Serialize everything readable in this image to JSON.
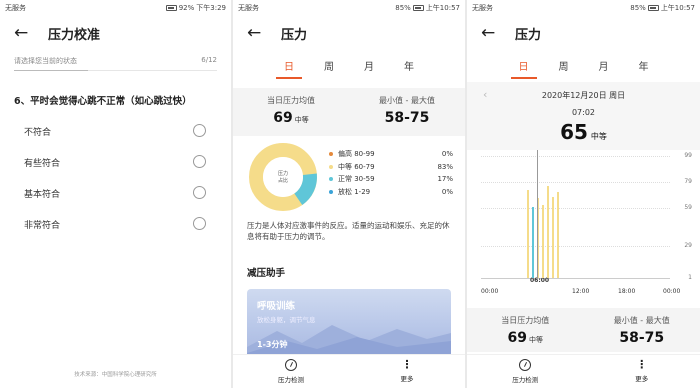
{
  "screen1": {
    "status": {
      "left": "无服务",
      "battery": "92%",
      "time": "下午3:29"
    },
    "title": "压力校准",
    "hint": "请选择您当前的状态",
    "page": "6/12",
    "question": "6、平时会觉得心跳不正常（如心跳过快）",
    "options": [
      "不符合",
      "有些符合",
      "基本符合",
      "非常符合"
    ],
    "source": "技术来源：中国科学院心理研究所"
  },
  "screen2": {
    "status": {
      "left": "无服务",
      "battery": "85%",
      "time": "上午10:57"
    },
    "title": "压力",
    "tabs": [
      "日",
      "周",
      "月",
      "年"
    ],
    "avg_label": "当日压力均值",
    "avg_value": "69",
    "avg_unit": "中等",
    "range_label": "最小值 - 最大值",
    "range_value": "58-75",
    "donut_center": "压力\n占比",
    "legend": [
      {
        "label": "偏高 80-99",
        "pct": "0%",
        "color": "#e58a3c"
      },
      {
        "label": "中等 60-79",
        "pct": "83%",
        "color": "#f5dc8a"
      },
      {
        "label": "正常 30-59",
        "pct": "17%",
        "color": "#5fc6d8"
      },
      {
        "label": "放松 1-29",
        "pct": "0%",
        "color": "#3aa3d8"
      }
    ],
    "description": "压力是人体对应激事件的反应。适量的运动和娱乐、充足的休息将有助于压力的调节。",
    "section_title": "减压助手",
    "card": {
      "title": "呼吸训练",
      "subtitle": "放松身躯，调节气息",
      "duration": "1-3分钟"
    },
    "bottom": {
      "detect": "压力检测",
      "more": "更多"
    }
  },
  "screen3": {
    "status": {
      "left": "无服务",
      "battery": "85%",
      "time": "上午10:57"
    },
    "title": "压力",
    "tabs": [
      "日",
      "周",
      "月",
      "年"
    ],
    "date": "2020年12月20日 周日",
    "time": "07:02",
    "value": "65",
    "unit": "中等",
    "y_ticks": [
      "99",
      "79",
      "59",
      "29",
      "1"
    ],
    "x_ticks": [
      "00:00",
      "06:00",
      "12:00",
      "18:00",
      "00:00"
    ],
    "avg_label": "当日压力均值",
    "avg_value": "69",
    "avg_unit": "中等",
    "range_label": "最小值 - 最大值",
    "range_value": "58-75",
    "bottom": {
      "detect": "压力检测",
      "more": "更多"
    }
  },
  "chart_data": {
    "type": "bar",
    "x": [
      "06:40",
      "06:50",
      "07:02",
      "07:10",
      "07:20",
      "07:30",
      "07:40"
    ],
    "values": [
      72,
      58,
      65,
      60,
      75,
      66,
      70
    ],
    "ylim": [
      1,
      99
    ],
    "yticks": [
      99,
      79,
      59,
      29,
      1
    ],
    "xticks": [
      "00:00",
      "06:00",
      "12:00",
      "18:00",
      "00:00"
    ],
    "colors": {
      "中等": "#f5dc8a",
      "正常": "#5fc6d8"
    }
  }
}
